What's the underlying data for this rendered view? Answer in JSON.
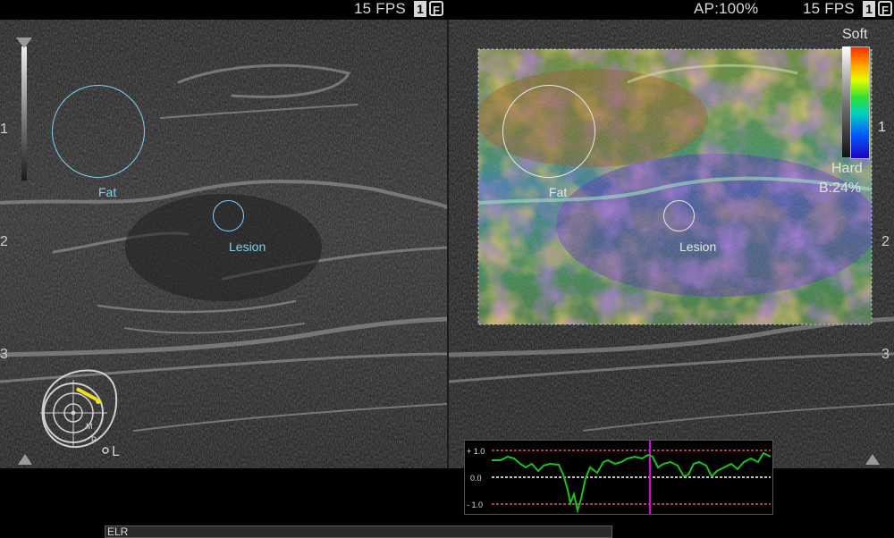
{
  "header": {
    "left_fps": "15 FPS",
    "left_frame": "1",
    "left_mode": "F",
    "ap": "AP:100%",
    "right_fps": "15 FPS",
    "right_frame": "1",
    "right_mode": "F"
  },
  "left_image": {
    "roi_fat_label": "Fat",
    "roi_lesion_label": "Lesion",
    "depth_marks": [
      "1",
      "2",
      "3"
    ],
    "body_marker_side": "L",
    "body_marker_labels": [
      "M",
      "P"
    ]
  },
  "right_image": {
    "roi_fat_label": "Fat",
    "roi_lesion_label": "Lesion",
    "depth_marks": [
      "1",
      "2",
      "3"
    ],
    "scale_top": "Soft",
    "scale_bottom": "Hard",
    "scale_mark": "1",
    "b_ratio": "B:24%"
  },
  "strain_graph": {
    "y_labels": [
      "+ 1.0",
      "0.0",
      "- 1.0"
    ],
    "type": "line",
    "ylim": [
      -1.0,
      1.0
    ],
    "colors": {
      "trace": "#19c319",
      "limit": "#e0506a",
      "zero": "#ffffff",
      "cursor": "#e000e0"
    }
  },
  "footer": {
    "label": "ELR"
  }
}
